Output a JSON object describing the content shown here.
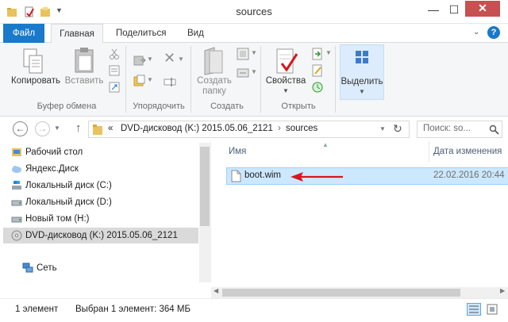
{
  "window": {
    "title": "sources",
    "minimize": "—",
    "maximize": "☐",
    "close": "✕"
  },
  "ribbon_tabs": {
    "file": "Файл",
    "home": "Главная",
    "share": "Поделиться",
    "view": "Вид"
  },
  "ribbon": {
    "copy": "Копировать",
    "paste": "Вставить",
    "clipboard_group": "Буфер обмена",
    "organize_group": "Упорядочить",
    "new_folder_line1": "Создать",
    "new_folder_line2": "папку",
    "create_group": "Создать",
    "properties": "Свойства",
    "open_group": "Открыть",
    "select": "Выделить",
    "help": "?"
  },
  "address": {
    "prefix": "«",
    "segment1": "DVD-дисковод (K:) 2015.05.06_2121",
    "separator": "›",
    "segment2": "sources",
    "search_placeholder": "Поиск: so..."
  },
  "nav_pane": {
    "items": [
      {
        "label": "Рабочий стол"
      },
      {
        "label": "Яндекс.Диск"
      },
      {
        "label": "Локальный диск (C:)"
      },
      {
        "label": "Локальный диск (D:)"
      },
      {
        "label": "Новый том (H:)"
      },
      {
        "label": "DVD-дисковод (K:) 2015.05.06_2121"
      },
      {
        "label": "Сеть"
      }
    ]
  },
  "file_list": {
    "col_name": "Имя",
    "col_date": "Дата изменения",
    "rows": [
      {
        "name": "boot.wim",
        "date": "22.02.2016 20:44"
      }
    ]
  },
  "status": {
    "count": "1 элемент",
    "selection": "Выбран 1 элемент: 364 МБ"
  },
  "colors": {
    "accent": "#1979ca",
    "selection": "#cce8ff",
    "arrow": "#d9151b"
  }
}
